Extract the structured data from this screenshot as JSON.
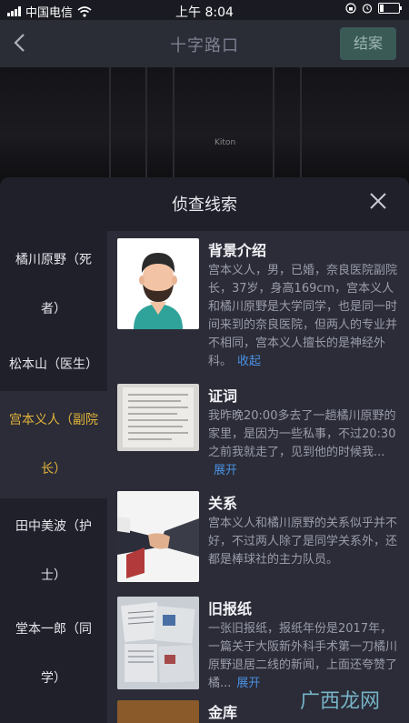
{
  "status": {
    "carrier": "中国电信",
    "time": "上午 8:04"
  },
  "nav": {
    "title": "十字路口",
    "action_label": "结案"
  },
  "scene": {
    "sign_text": "Kiton"
  },
  "sheet": {
    "title": "侦查线索",
    "characters": [
      {
        "label": "橘川原野（死者）"
      },
      {
        "label": "松本山（医生）"
      },
      {
        "label": "宫本义人（副院长）",
        "active": true
      },
      {
        "label": "田中美波（护士）"
      },
      {
        "label": "堂本一郎（同学）"
      }
    ],
    "clues": [
      {
        "title": "背景介绍",
        "body": "宫本义人，男，已婚，奈良医院副院长，37岁，身高169cm，宫本义人和橘川原野是大学同学，也是同一时间来到的奈良医院，但两人的专业并不相同，宫本义人擅长的是神经外科。",
        "toggle": "收起"
      },
      {
        "title": "证词",
        "body": "我昨晚20:00多去了一趟橘川原野的家里，是因为一些私事，不过20:30之前我就走了，见到他的时候我...",
        "toggle": "展开"
      },
      {
        "title": "关系",
        "body": "宫本义人和橘川原野的关系似乎并不好，不过两人除了是同学关系外，还都是棒球社的主力队员。",
        "toggle": ""
      },
      {
        "title": "旧报纸",
        "body": "一张旧报纸，报纸年份是2017年，一篇关于大阪新外科手术第一刀橘川原野退居二线的新闻，上面还夸赞了橘...",
        "toggle": "展开"
      },
      {
        "title": "金库",
        "body": "",
        "toggle": ""
      }
    ]
  },
  "watermark": "广西龙网",
  "colors": {
    "accent_active": "#e2b33b",
    "link": "#4a90e2",
    "sheet_bg": "#1f2029",
    "content_bg": "#2b2c37"
  }
}
